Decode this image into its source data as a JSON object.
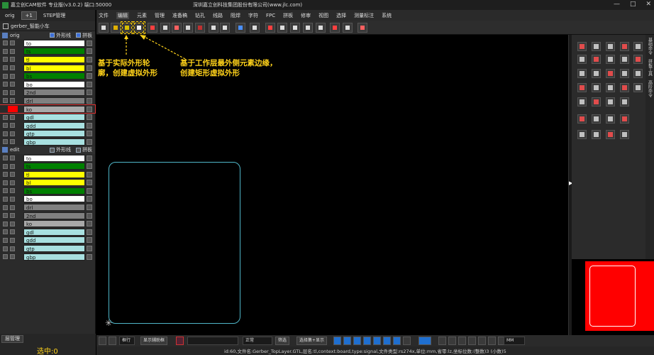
{
  "titlebar": {
    "title": "嘉立创CAM软件 专业版(v3.0.2) 端口:50000",
    "company": "深圳嘉立创科技集团股份有限公司(www.jlc.com)",
    "min_glyph": "—",
    "max_glyph": "□",
    "close_glyph": "✕"
  },
  "left_panel": {
    "tabs": [
      "orig",
      "+1",
      "STEP管理"
    ],
    "job_name": "gerber_智能小车",
    "orig_section": {
      "name": "orig",
      "opt1": "外形线",
      "opt2": "拼板"
    },
    "edit_section": {
      "name": "edit",
      "opt1": "外形线",
      "opt2": "拼板"
    },
    "orig_layers": [
      {
        "name": "to",
        "color": "#ffffff"
      },
      {
        "name": "ts",
        "color": "#008000"
      },
      {
        "name": "tl",
        "color": "#ffff00"
      },
      {
        "name": "bl",
        "color": "#ffff00"
      },
      {
        "name": "bs",
        "color": "#008000"
      },
      {
        "name": "bo",
        "color": "#ffffff"
      },
      {
        "name": "2nd",
        "color": "#808080"
      },
      {
        "name": "drl",
        "color": "#808080"
      },
      {
        "name": "ko",
        "color": "#a9a9a9"
      },
      {
        "name": "gdl",
        "color": "#a8e0e0"
      },
      {
        "name": "gdd",
        "color": "#a8e0e0"
      },
      {
        "name": "gtp",
        "color": "#a8e0e0"
      },
      {
        "name": "gbp",
        "color": "#a8e0e0"
      }
    ],
    "edit_layers": [
      {
        "name": "to",
        "color": "#ffffff"
      },
      {
        "name": "ts",
        "color": "#008000"
      },
      {
        "name": "tl",
        "color": "#ffff00"
      },
      {
        "name": "bl",
        "color": "#ffff00"
      },
      {
        "name": "bs",
        "color": "#008000"
      },
      {
        "name": "bo",
        "color": "#ffffff"
      },
      {
        "name": "drl",
        "color": "#808080"
      },
      {
        "name": "2nd",
        "color": "#808080"
      },
      {
        "name": "ko",
        "color": "#a9a9a9"
      },
      {
        "name": "gdl",
        "color": "#a8e0e0"
      },
      {
        "name": "gdd",
        "color": "#a8e0e0"
      },
      {
        "name": "gtp",
        "color": "#a8e0e0"
      },
      {
        "name": "gbp",
        "color": "#a8e0e0"
      }
    ],
    "layer_manager_label": "层管理",
    "selected_count": "选中:0"
  },
  "menubar": [
    "文件",
    "编辑",
    "元素",
    "管理",
    "准备稿",
    "钻孔",
    "线路",
    "阻焊",
    "字符",
    "FPC",
    "拼板",
    "修审",
    "视图",
    "选择",
    "测量标注",
    "系统"
  ],
  "annotations": {
    "left_line1": "基于实际外形轮",
    "left_line2": "廓，创建虚拟外形",
    "right_line1": "基于工作层最外侧元素边缘，",
    "right_line2": "创建矩形虚拟外形"
  },
  "canvas": {
    "origin_glyph": "✳"
  },
  "right_vtabs": [
    "基础命令",
    "拼板工具",
    "高阶命令"
  ],
  "bottom": {
    "mode_value": "框行",
    "display_btn": "显示辅助框",
    "line_style": "正常",
    "filter_label": "筛选",
    "select_all_label": "选择集+显示",
    "unit": "MM"
  },
  "status_text": "id:60,文件名:Gerber_TopLayer.GTL,层名:tl,context:board,type:signal,文件类型:rs274x,单位:mm,省零:lz,坐标位数:(整数)3 (小数)5",
  "colors": {
    "accent": "#ffd21a",
    "board_outline": "#4fb6c8",
    "preview_fill": "#ff0000"
  }
}
